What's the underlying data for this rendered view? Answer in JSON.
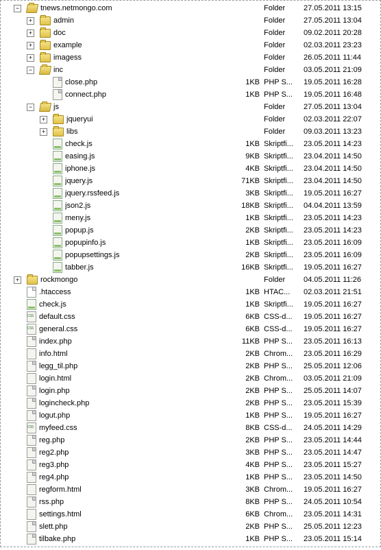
{
  "tree": [
    {
      "depth": 0,
      "exp": "minus",
      "icon": "folder-open",
      "name": "tnews.netmongo.com",
      "size": "",
      "type": "Folder",
      "date": "27.05.2011 13:15"
    },
    {
      "depth": 1,
      "exp": "plus",
      "icon": "folder-closed",
      "name": "admin",
      "size": "",
      "type": "Folder",
      "date": "27.05.2011 13:04"
    },
    {
      "depth": 1,
      "exp": "plus",
      "icon": "folder-closed",
      "name": "doc",
      "size": "",
      "type": "Folder",
      "date": "09.02.2011 20:28"
    },
    {
      "depth": 1,
      "exp": "plus",
      "icon": "folder-closed",
      "name": "example",
      "size": "",
      "type": "Folder",
      "date": "02.03.2011 23:23"
    },
    {
      "depth": 1,
      "exp": "plus",
      "icon": "folder-closed",
      "name": "imagess",
      "size": "",
      "type": "Folder",
      "date": "26.05.2011 11:44"
    },
    {
      "depth": 1,
      "exp": "minus",
      "icon": "folder-open",
      "name": "inc",
      "size": "",
      "type": "Folder",
      "date": "03.05.2011 21:09"
    },
    {
      "depth": 2,
      "exp": "none",
      "icon": "file-php",
      "name": "close.php",
      "size": "1KB",
      "type": "PHP S...",
      "date": "19.05.2011 16:28"
    },
    {
      "depth": 2,
      "exp": "none",
      "icon": "file-php",
      "name": "connect.php",
      "size": "1KB",
      "type": "PHP S...",
      "date": "19.05.2011 16:48"
    },
    {
      "depth": 1,
      "exp": "minus",
      "icon": "folder-open",
      "name": "js",
      "size": "",
      "type": "Folder",
      "date": "27.05.2011 13:04"
    },
    {
      "depth": 2,
      "exp": "plus",
      "icon": "folder-closed",
      "name": "jqueryui",
      "size": "",
      "type": "Folder",
      "date": "02.03.2011 22:07"
    },
    {
      "depth": 2,
      "exp": "plus",
      "icon": "folder-closed",
      "name": "libs",
      "size": "",
      "type": "Folder",
      "date": "09.03.2011 13:23"
    },
    {
      "depth": 2,
      "exp": "none",
      "icon": "file-js",
      "name": "check.js",
      "size": "1KB",
      "type": "Skriptfi...",
      "date": "23.05.2011 14:23"
    },
    {
      "depth": 2,
      "exp": "none",
      "icon": "file-js",
      "name": "easing.js",
      "size": "9KB",
      "type": "Skriptfi...",
      "date": "23.04.2011 14:50"
    },
    {
      "depth": 2,
      "exp": "none",
      "icon": "file-js",
      "name": "iphone.js",
      "size": "4KB",
      "type": "Skriptfi...",
      "date": "23.04.2011 14:50"
    },
    {
      "depth": 2,
      "exp": "none",
      "icon": "file-js",
      "name": "jquery.js",
      "size": "71KB",
      "type": "Skriptfi...",
      "date": "23.04.2011 14:50"
    },
    {
      "depth": 2,
      "exp": "none",
      "icon": "file-js",
      "name": "jquery.rssfeed.js",
      "size": "3KB",
      "type": "Skriptfi...",
      "date": "19.05.2011 16:27"
    },
    {
      "depth": 2,
      "exp": "none",
      "icon": "file-js",
      "name": "json2.js",
      "size": "18KB",
      "type": "Skriptfi...",
      "date": "04.04.2011 13:59"
    },
    {
      "depth": 2,
      "exp": "none",
      "icon": "file-js",
      "name": "meny.js",
      "size": "1KB",
      "type": "Skriptfi...",
      "date": "23.05.2011 14:23"
    },
    {
      "depth": 2,
      "exp": "none",
      "icon": "file-js",
      "name": "popup.js",
      "size": "2KB",
      "type": "Skriptfi...",
      "date": "23.05.2011 14:23"
    },
    {
      "depth": 2,
      "exp": "none",
      "icon": "file-js",
      "name": "popupinfo.js",
      "size": "1KB",
      "type": "Skriptfi...",
      "date": "23.05.2011 16:09"
    },
    {
      "depth": 2,
      "exp": "none",
      "icon": "file-js",
      "name": "popupsettings.js",
      "size": "2KB",
      "type": "Skriptfi...",
      "date": "23.05.2011 16:09"
    },
    {
      "depth": 2,
      "exp": "none",
      "icon": "file-js",
      "name": "tabber.js",
      "size": "16KB",
      "type": "Skriptfi...",
      "date": "19.05.2011 16:27"
    },
    {
      "depth": 0,
      "exp": "plus",
      "icon": "folder-closed",
      "name": "rockmongo",
      "size": "",
      "type": "Folder",
      "date": "04.05.2011 11:26"
    },
    {
      "depth": 0,
      "exp": "none",
      "icon": "file-generic",
      "name": ".htaccess",
      "size": "1KB",
      "type": "HTAC...",
      "date": "02.03.2011 21:51"
    },
    {
      "depth": 0,
      "exp": "none",
      "icon": "file-js",
      "name": "check.js",
      "size": "1KB",
      "type": "Skriptfi...",
      "date": "19.05.2011 16:27"
    },
    {
      "depth": 0,
      "exp": "none",
      "icon": "file-css",
      "name": "default.css",
      "size": "6KB",
      "type": "CSS-d...",
      "date": "19.05.2011 16:27"
    },
    {
      "depth": 0,
      "exp": "none",
      "icon": "file-css",
      "name": "general.css",
      "size": "6KB",
      "type": "CSS-d...",
      "date": "19.05.2011 16:27"
    },
    {
      "depth": 0,
      "exp": "none",
      "icon": "file-php",
      "name": "index.php",
      "size": "11KB",
      "type": "PHP S...",
      "date": "23.05.2011 16:13"
    },
    {
      "depth": 0,
      "exp": "none",
      "icon": "file-html",
      "name": "info.html",
      "size": "2KB",
      "type": "Chrom...",
      "date": "23.05.2011 16:29"
    },
    {
      "depth": 0,
      "exp": "none",
      "icon": "file-php",
      "name": "legg_til.php",
      "size": "2KB",
      "type": "PHP S...",
      "date": "25.05.2011 12:06"
    },
    {
      "depth": 0,
      "exp": "none",
      "icon": "file-html",
      "name": "login.html",
      "size": "2KB",
      "type": "Chrom...",
      "date": "03.05.2011 21:09"
    },
    {
      "depth": 0,
      "exp": "none",
      "icon": "file-php",
      "name": "login.php",
      "size": "2KB",
      "type": "PHP S...",
      "date": "25.05.2011 14:07"
    },
    {
      "depth": 0,
      "exp": "none",
      "icon": "file-php",
      "name": "logincheck.php",
      "size": "2KB",
      "type": "PHP S...",
      "date": "23.05.2011 15:39"
    },
    {
      "depth": 0,
      "exp": "none",
      "icon": "file-php",
      "name": "logut.php",
      "size": "1KB",
      "type": "PHP S...",
      "date": "19.05.2011 16:27"
    },
    {
      "depth": 0,
      "exp": "none",
      "icon": "file-css",
      "name": "myfeed.css",
      "size": "8KB",
      "type": "CSS-d...",
      "date": "24.05.2011 14:29"
    },
    {
      "depth": 0,
      "exp": "none",
      "icon": "file-php",
      "name": "reg.php",
      "size": "2KB",
      "type": "PHP S...",
      "date": "23.05.2011 14:44"
    },
    {
      "depth": 0,
      "exp": "none",
      "icon": "file-php",
      "name": "reg2.php",
      "size": "3KB",
      "type": "PHP S...",
      "date": "23.05.2011 14:47"
    },
    {
      "depth": 0,
      "exp": "none",
      "icon": "file-php",
      "name": "reg3.php",
      "size": "4KB",
      "type": "PHP S...",
      "date": "23.05.2011 15:27"
    },
    {
      "depth": 0,
      "exp": "none",
      "icon": "file-php",
      "name": "reg4.php",
      "size": "1KB",
      "type": "PHP S...",
      "date": "23.05.2011 14:50"
    },
    {
      "depth": 0,
      "exp": "none",
      "icon": "file-html",
      "name": "regform.html",
      "size": "3KB",
      "type": "Chrom...",
      "date": "19.05.2011 16:27"
    },
    {
      "depth": 0,
      "exp": "none",
      "icon": "file-php",
      "name": "rss.php",
      "size": "8KB",
      "type": "PHP S...",
      "date": "24.05.2011 10:54"
    },
    {
      "depth": 0,
      "exp": "none",
      "icon": "file-html",
      "name": "settings.html",
      "size": "6KB",
      "type": "Chrom...",
      "date": "23.05.2011 14:31"
    },
    {
      "depth": 0,
      "exp": "none",
      "icon": "file-php",
      "name": "slett.php",
      "size": "2KB",
      "type": "PHP S...",
      "date": "25.05.2011 12:23"
    },
    {
      "depth": 0,
      "exp": "none",
      "icon": "file-php",
      "name": "tilbake.php",
      "size": "1KB",
      "type": "PHP S...",
      "date": "23.05.2011 15:14"
    }
  ]
}
